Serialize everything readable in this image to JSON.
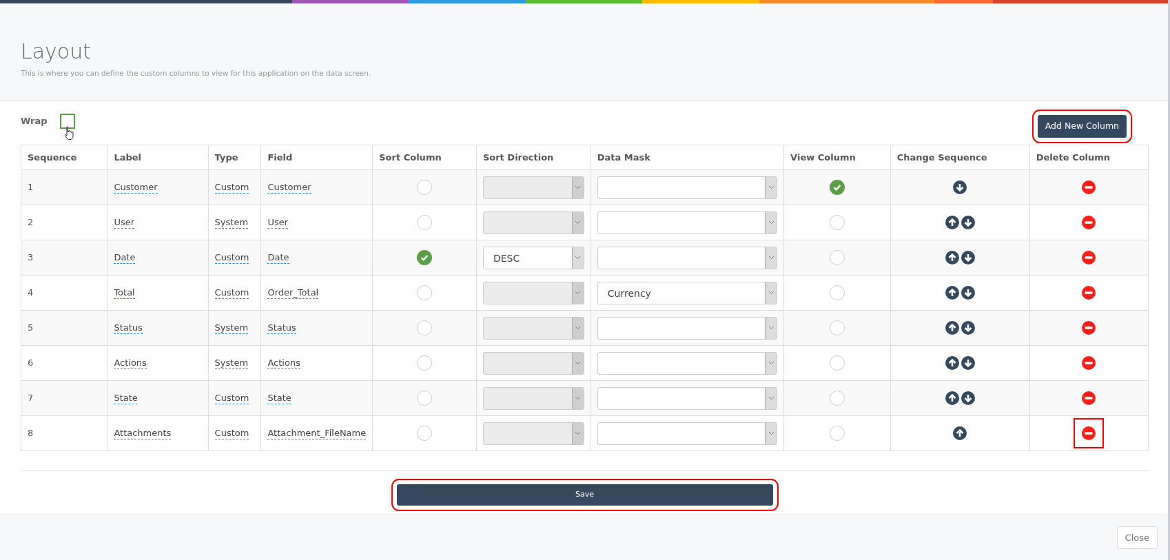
{
  "header": {
    "title": "Layout",
    "subtitle": "This is where you can define the custom columns to view for this application on the data screen."
  },
  "wrap": {
    "label": "Wrap",
    "checked": false
  },
  "add_button": {
    "label": "Add New Column",
    "highlighted": true
  },
  "table": {
    "columns": [
      "Sequence",
      "Label",
      "Type",
      "Field",
      "Sort Column",
      "Sort Direction",
      "Data Mask",
      "View Column",
      "Change Sequence",
      "Delete Column"
    ],
    "rows": [
      {
        "sequence": "1",
        "label": "Customer",
        "type": "Custom",
        "field": "Customer",
        "sort": false,
        "direction": {
          "disabled": true
        },
        "mask": "",
        "view": true,
        "up": false,
        "down": true,
        "delete_highlighted": false
      },
      {
        "sequence": "2",
        "label": "User",
        "type": "System",
        "field": "User",
        "sort": false,
        "direction": {
          "disabled": true
        },
        "mask": "",
        "view": false,
        "up": true,
        "down": true,
        "delete_highlighted": false
      },
      {
        "sequence": "3",
        "label": "Date",
        "type": "Custom",
        "field": "Date",
        "sort": true,
        "direction": {
          "disabled": false,
          "value": "DESC"
        },
        "mask": "",
        "view": false,
        "up": true,
        "down": true,
        "delete_highlighted": false
      },
      {
        "sequence": "4",
        "label": "Total",
        "type": "Custom",
        "field": "Order_Total",
        "sort": false,
        "direction": {
          "disabled": true
        },
        "mask": "Currency",
        "view": false,
        "up": true,
        "down": true,
        "delete_highlighted": false
      },
      {
        "sequence": "5",
        "label": "Status",
        "type": "System",
        "field": "Status",
        "sort": false,
        "direction": {
          "disabled": true
        },
        "mask": "",
        "view": false,
        "up": true,
        "down": true,
        "delete_highlighted": false
      },
      {
        "sequence": "6",
        "label": "Actions",
        "type": "System",
        "field": "Actions",
        "sort": false,
        "direction": {
          "disabled": true
        },
        "mask": "",
        "view": false,
        "up": true,
        "down": true,
        "delete_highlighted": false
      },
      {
        "sequence": "7",
        "label": "State",
        "type": "Custom",
        "field": "State",
        "sort": false,
        "direction": {
          "disabled": true
        },
        "mask": "",
        "view": false,
        "up": true,
        "down": true,
        "delete_highlighted": false
      },
      {
        "sequence": "8",
        "label": "Attachments",
        "type": "Custom",
        "field": "Attachment_FileName",
        "sort": false,
        "direction": {
          "disabled": true
        },
        "mask": "",
        "view": false,
        "up": true,
        "down": false,
        "delete_highlighted": true
      }
    ]
  },
  "save_button": {
    "label": "Save",
    "highlighted": true
  },
  "footer": {
    "close_label": "Close"
  }
}
